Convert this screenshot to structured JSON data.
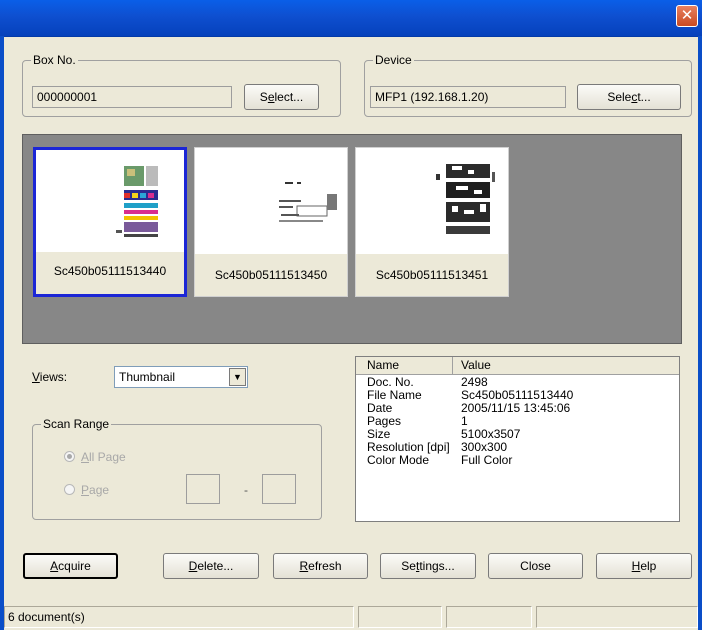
{
  "window": {
    "close_glyph": "✕"
  },
  "box": {
    "legend": "Box No.",
    "value": "000000001",
    "select_pre": "S",
    "select_key": "e",
    "select_post": "lect..."
  },
  "device": {
    "legend": "Device",
    "value": "MFP1 (192.168.1.20)",
    "select_pre": "Sele",
    "select_key": "c",
    "select_post": "t..."
  },
  "thumbnails": [
    {
      "name": "Sc450b05111513440",
      "selected": true
    },
    {
      "name": "Sc450b05111513450",
      "selected": false
    },
    {
      "name": "Sc450b05111513451",
      "selected": false
    }
  ],
  "views": {
    "label_key": "V",
    "label_rest": "iews:",
    "selected": "Thumbnail"
  },
  "scan_range": {
    "legend": "Scan Range",
    "all_key": "A",
    "all_rest": "ll Page",
    "page_key": "P",
    "page_rest": "age",
    "dash": "-"
  },
  "properties": {
    "col_name": "Name",
    "col_value": "Value",
    "rows": [
      {
        "name": "Doc. No.",
        "value": "2498"
      },
      {
        "name": "File Name",
        "value": "Sc450b05111513440"
      },
      {
        "name": "Date",
        "value": "2005/11/15 13:45:06"
      },
      {
        "name": "Pages",
        "value": "1"
      },
      {
        "name": "Size",
        "value": "5100x3507"
      },
      {
        "name": "Resolution [dpi]",
        "value": "300x300"
      },
      {
        "name": "Color Mode",
        "value": "Full Color"
      }
    ]
  },
  "buttons": {
    "acquire_key": "A",
    "acquire_rest": "cquire",
    "delete_key": "D",
    "delete_rest": "elete...",
    "refresh_key": "R",
    "refresh_rest": "efresh",
    "settings_pre": "Se",
    "settings_key": "t",
    "settings_post": "tings...",
    "close": "Close",
    "help_key": "H",
    "help_rest": "elp"
  },
  "status": {
    "text": "6 document(s)"
  },
  "colors": {
    "title_blue": "#0a5fe8",
    "selection_blue": "#1b26d6",
    "thumb_bg": "#878787"
  }
}
